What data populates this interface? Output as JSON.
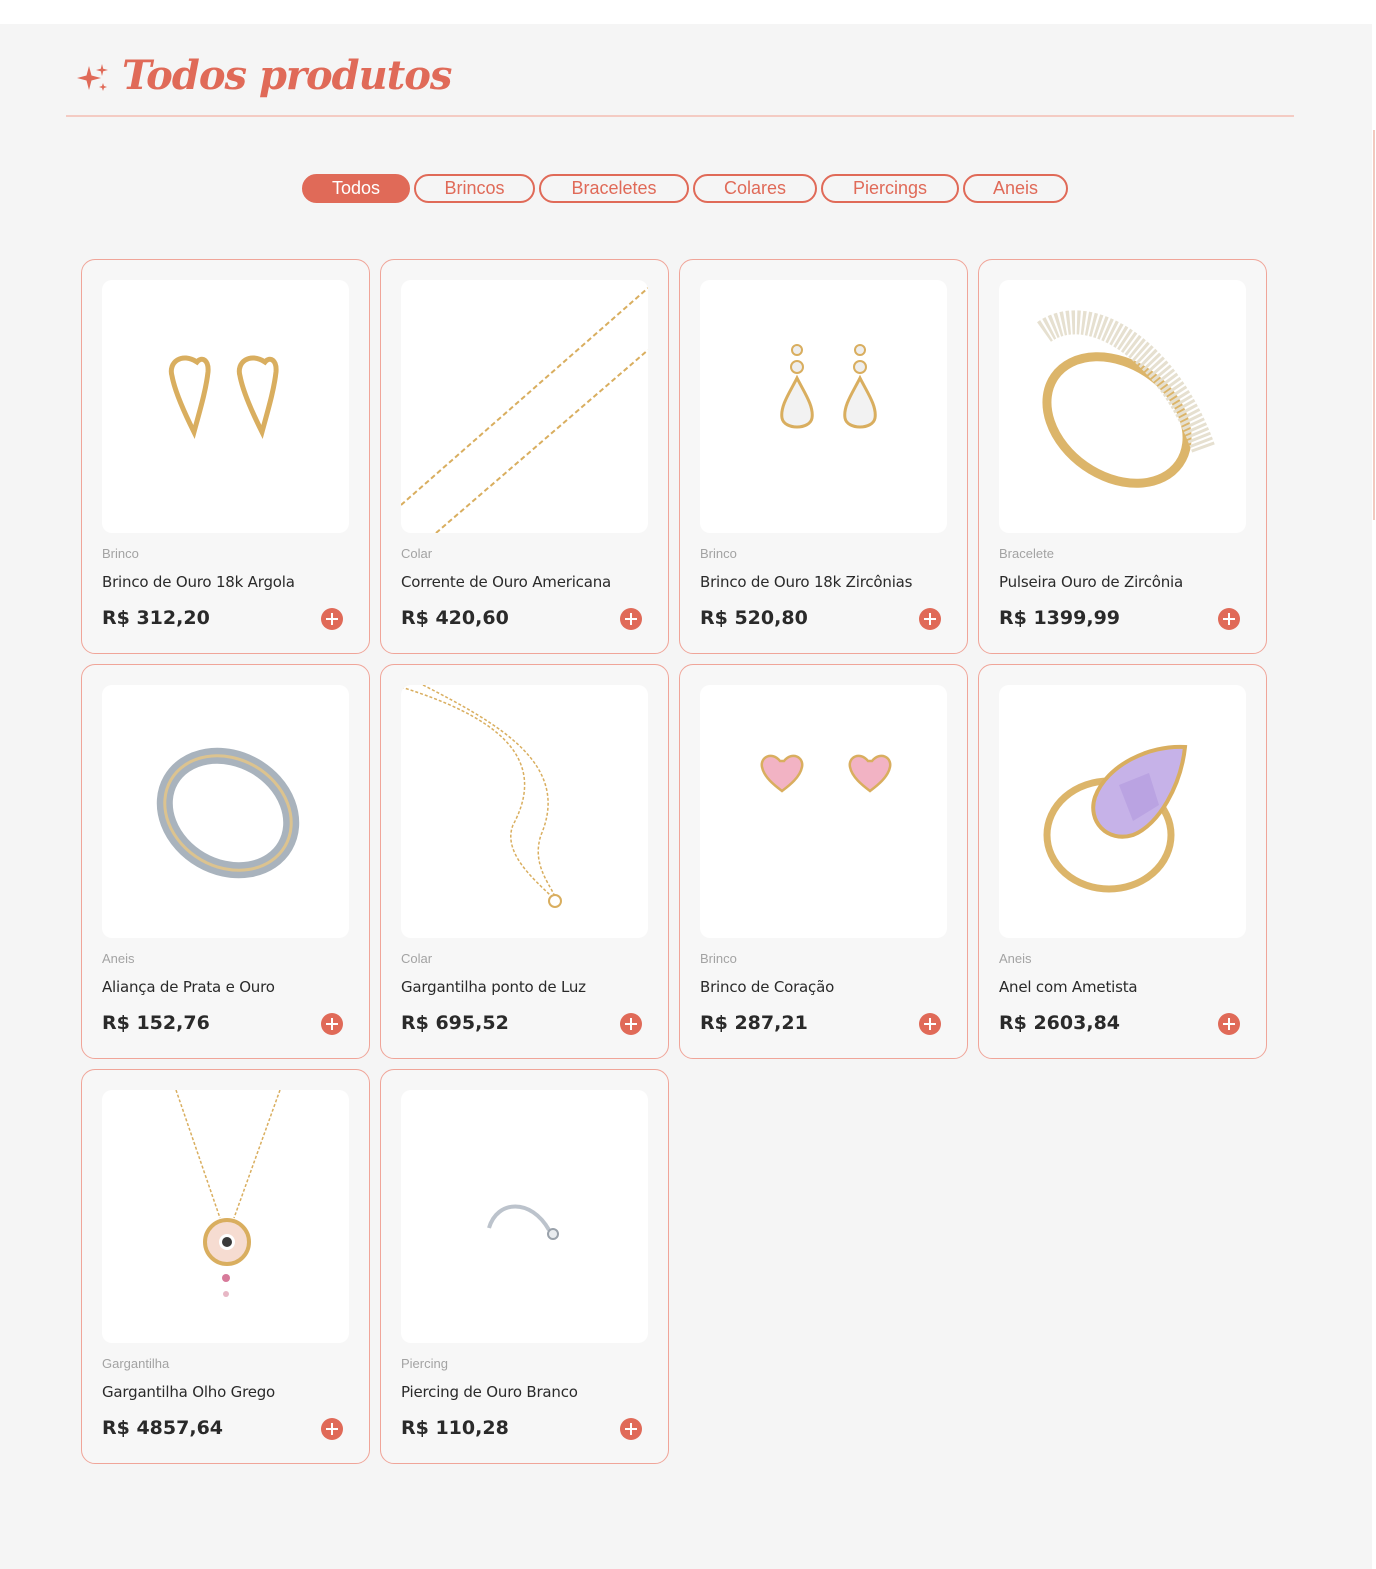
{
  "section": {
    "title": "Todos produtos"
  },
  "filters": [
    {
      "label": "Todos",
      "active": true
    },
    {
      "label": "Brincos",
      "active": false
    },
    {
      "label": "Braceletes",
      "active": false
    },
    {
      "label": "Colares",
      "active": false
    },
    {
      "label": "Piercings",
      "active": false
    },
    {
      "label": "Aneis",
      "active": false
    }
  ],
  "products": [
    {
      "category": "Brinco",
      "name": "Brinco de Ouro 18k Argola",
      "price": "R$ 312,20",
      "image": "gold-heart-hoop-earrings"
    },
    {
      "category": "Colar",
      "name": "Corrente de Ouro Americana",
      "price": "R$ 420,60",
      "image": "gold-chain"
    },
    {
      "category": "Brinco",
      "name": "Brinco de Ouro 18k Zircônias",
      "price": "R$ 520,80",
      "image": "zirconia-drop-earrings"
    },
    {
      "category": "Bracelete",
      "name": "Pulseira Ouro de Zircônia",
      "price": "R$ 1399,99",
      "image": "zirconia-gold-bangle"
    },
    {
      "category": "Aneis",
      "name": "Aliança de Prata e Ouro",
      "price": "R$ 152,76",
      "image": "silver-gold-band-ring"
    },
    {
      "category": "Colar",
      "name": "Gargantilha ponto de Luz",
      "price": "R$ 695,52",
      "image": "gold-necklace-pendant"
    },
    {
      "category": "Brinco",
      "name": "Brinco de Coração",
      "price": "R$ 287,21",
      "image": "pink-heart-stud-earrings"
    },
    {
      "category": "Aneis",
      "name": "Anel com Ametista",
      "price": "R$ 2603,84",
      "image": "amethyst-gold-ring"
    },
    {
      "category": "Gargantilha",
      "name": "Gargantilha Olho Grego",
      "price": "R$ 4857,64",
      "image": "greek-eye-necklace"
    },
    {
      "category": "Piercing",
      "name": "Piercing de Ouro Branco",
      "price": "R$ 110,28",
      "image": "white-gold-nose-piercing"
    }
  ],
  "colors": {
    "accent": "#e06a58",
    "border": "#f0a599",
    "gold": "#d9ae5f"
  }
}
